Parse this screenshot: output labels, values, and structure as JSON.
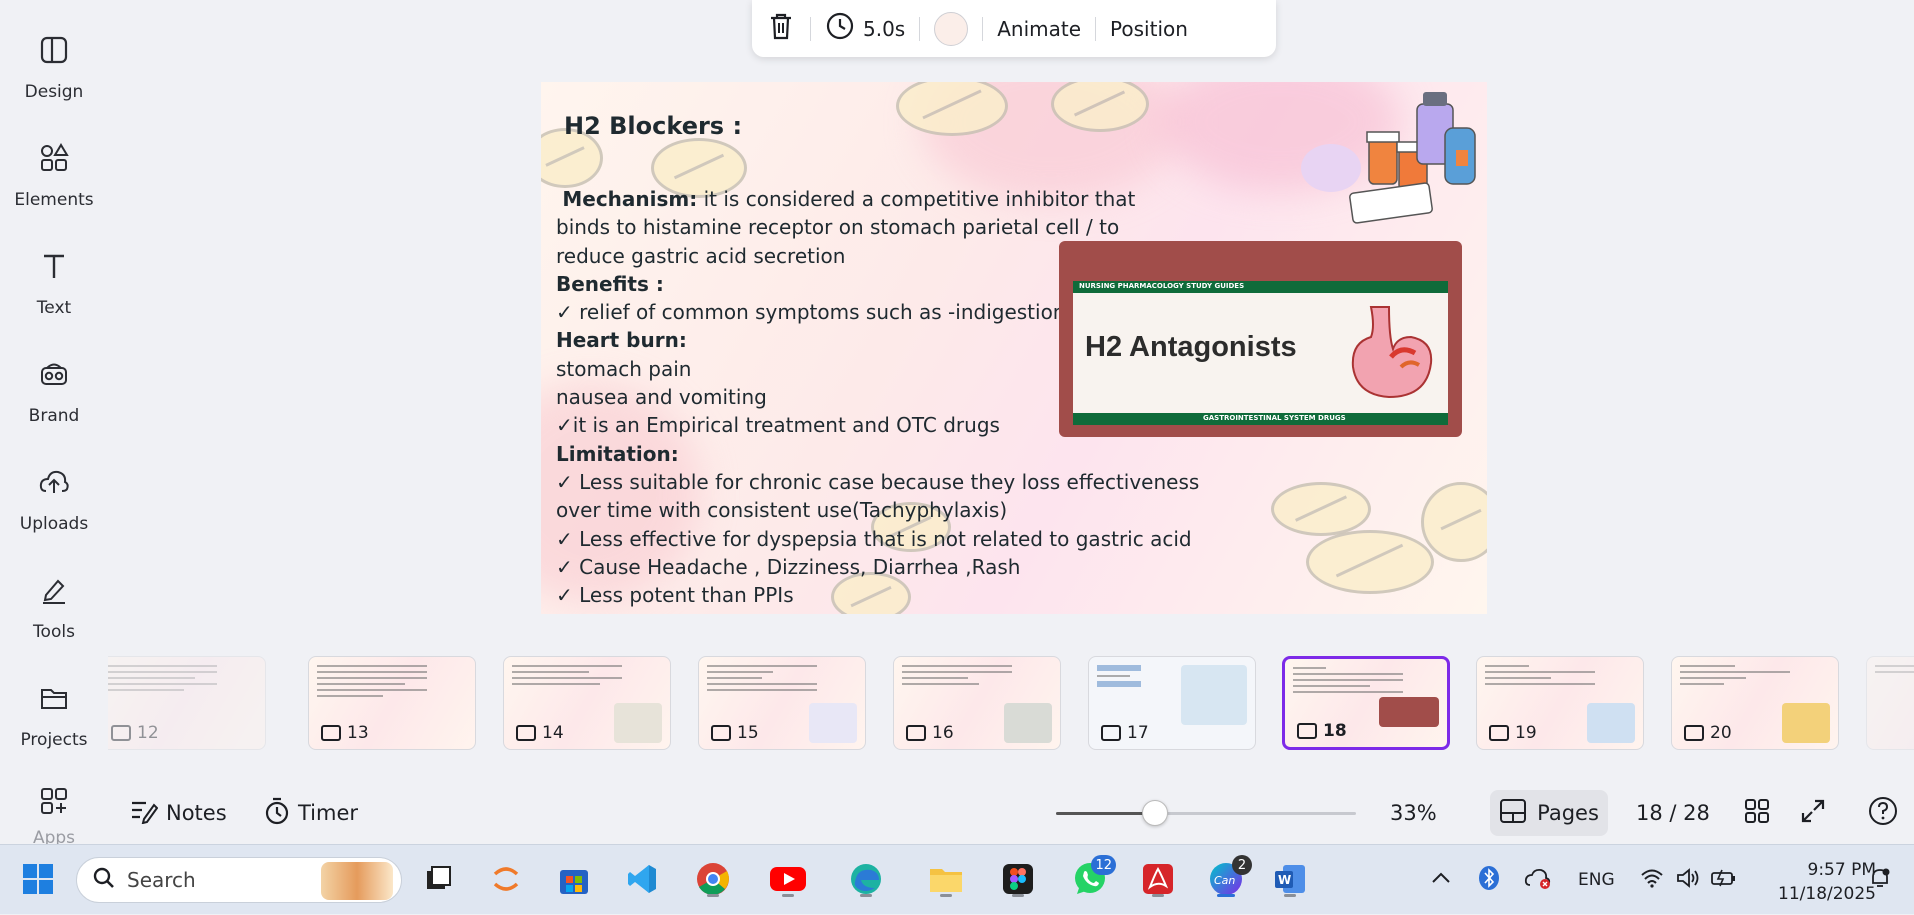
{
  "sidebar": {
    "items": [
      {
        "label": "Design",
        "icon": "design-icon"
      },
      {
        "label": "Elements",
        "icon": "elements-icon"
      },
      {
        "label": "Text",
        "icon": "text-icon"
      },
      {
        "label": "Brand",
        "icon": "brand-icon"
      },
      {
        "label": "Uploads",
        "icon": "uploads-icon"
      },
      {
        "label": "Tools",
        "icon": "tools-icon"
      },
      {
        "label": "Projects",
        "icon": "projects-icon"
      },
      {
        "label": "Apps",
        "icon": "apps-icon"
      }
    ]
  },
  "toolbar": {
    "duration": "5.0s",
    "animate": "Animate",
    "position": "Position",
    "swatch_color": "#fbeee9"
  },
  "slide": {
    "title": "H2 Blockers :",
    "mechanism_label": "Mechanism:",
    "mechanism_text": " it is considered a competitive inhibitor that",
    "mechanism_line2": "binds to histamine receptor on stomach parietal cell / to",
    "mechanism_line3": "reduce gastric acid secretion",
    "benefits_label": "Benefits :",
    "benefit_1": "✓ relief of common symptoms such as -indigestion",
    "heartburn_label": "Heart burn:",
    "symptom_1": "stomach pain",
    "symptom_2": "nausea and vomiting",
    "benefit_2": "✓it is an Empirical treatment and OTC drugs",
    "limitation_label": "Limitation:",
    "limit_1a": "✓ Less suitable for chronic case because they loss effectiveness",
    "limit_1b": "over time with consistent use(Tachyphylaxis)",
    "limit_2": "✓ Less effective for dyspepsia that is not related to gastric acid",
    "limit_3": "✓ Cause Headache , Dizziness, Diarrhea ,Rash",
    "limit_4": "✓ Less potent than PPIs",
    "image_banner_top": "NURSING PHARMACOLOGY STUDY GUIDES",
    "image_title": "H2 Antagonists",
    "image_banner_bottom": "GASTROINTESTINAL SYSTEM DRUGS"
  },
  "thumbnails": [
    {
      "num": "12",
      "active": false,
      "faded": true
    },
    {
      "num": "13",
      "active": false,
      "faded": false
    },
    {
      "num": "14",
      "active": false,
      "faded": false
    },
    {
      "num": "15",
      "active": false,
      "faded": false
    },
    {
      "num": "16",
      "active": false,
      "faded": false
    },
    {
      "num": "17",
      "active": false,
      "faded": false
    },
    {
      "num": "18",
      "active": true,
      "faded": false
    },
    {
      "num": "19",
      "active": false,
      "faded": false
    },
    {
      "num": "20",
      "active": false,
      "faded": false
    }
  ],
  "bottombar": {
    "notes": "Notes",
    "timer": "Timer",
    "zoom": "33%",
    "zoom_fraction": 0.33,
    "pages": "Pages",
    "page_indicator": "18 / 28"
  },
  "taskbar": {
    "search_placeholder": "Search",
    "whatsapp_badge": "12",
    "canva_badge": "2",
    "language": "ENG",
    "time": "9:57 PM",
    "date": "11/18/2025"
  },
  "colors": {
    "accent": "#7d2ae8",
    "taskbar": "#dfe6f1"
  }
}
